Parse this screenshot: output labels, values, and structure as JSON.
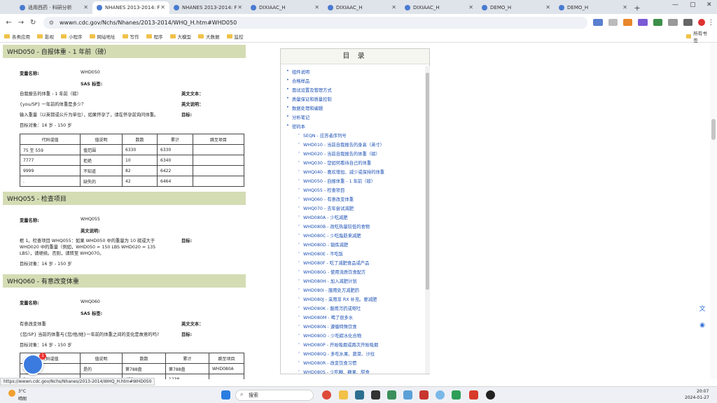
{
  "browser": {
    "tabs": [
      {
        "label": "适用西药 · 科研分析",
        "active": false
      },
      {
        "label": "NHANES 2013-2014: F",
        "active": true
      },
      {
        "label": "NHANES 2013-2014: F",
        "active": false
      },
      {
        "label": "DIXIAAC_H",
        "active": false
      },
      {
        "label": "DIXIAAC_H",
        "active": false
      },
      {
        "label": "DIXIAAC_H",
        "active": false
      },
      {
        "label": "DEMO_H",
        "active": false
      },
      {
        "label": "DEMO_H",
        "active": false
      }
    ],
    "new_tab": "+",
    "url": "wwwn.cdc.gov/Nchs/Nhanes/2013-2014/WHQ_H.htm#WHD050",
    "bookmarks": [
      "各类应用",
      "影视",
      "小程序",
      "网站地址",
      "写作",
      "程序",
      "大模型",
      "大数据",
      "监控"
    ],
    "bookmarks_right": "所有书签",
    "status_url": "https://wwwn.cdc.gov/Nchs/Nhanes/2013-2014/WHQ_H.htm#WHD050"
  },
  "sections": {
    "whd050": {
      "header": "WHD050 - 自报体重 - 1 年前（磅）",
      "var_label": "变量名称:",
      "var_value": "WHD050",
      "sas_label": "SAS 标签:",
      "desc": "自我报告的体重 - 1 年前（磅）",
      "q": "{you/SP} 一年前的体重是多少？",
      "instr": "输入重量（以英镑或公斤为单位），如果怀孕了，请在怀孕前询问体重。",
      "age": "目标对象：16 岁 - 150 岁",
      "en_text": "英文文本：",
      "en_instr": "英文说明：",
      "target": "目标:",
      "table": {
        "headers": [
          "代码或值",
          "值说明",
          "数数",
          "累计",
          "跳至项目"
        ],
        "rows": [
          [
            "75 至 559",
            "值范围",
            "6330",
            "6330",
            ""
          ],
          [
            "7777",
            "拒绝",
            "10",
            "6340",
            ""
          ],
          [
            "9999",
            "不知道",
            "82",
            "6422",
            ""
          ],
          [
            ".",
            "缺失的",
            "42",
            "6464",
            ""
          ]
        ]
      }
    },
    "whq055": {
      "header": "WHQ055 - 检查项目",
      "var_label": "变量名称:",
      "var_value": "WHQ055",
      "en_instr": "英文说明:",
      "instr1": "框 1。检查项目 WHQ055：如果 WHD050 中的重量为 10 磅或大于",
      "instr2": "WHD020 中的重量（例如，WHD050 = 150 LBS WHD020 = 135",
      "instr3": "LBS），请继续。否则，请转至 WHQ070。",
      "target": "目标:",
      "age": "目标对象：16 岁 - 150 岁"
    },
    "whq060": {
      "header": "WHQ060 - 有意改变体重",
      "var_label": "变量名称:",
      "var_value": "WHQ060",
      "sas_label": "SAS 标签:",
      "desc": "有意改变体重",
      "q": "{您/SP} 当前的体重与{您/他/她}一年前的体重之间的变化是故意的吗?",
      "age": "目标对象：16 岁 - 150 岁",
      "en_text": "英文文本：",
      "target": "目标:",
      "table": {
        "headers": [
          "代码或值",
          "值说明",
          "数数",
          "累计",
          "跳至项目"
        ],
        "rows": [
          [
            "1",
            "是的",
            "第788盘",
            "第788盘",
            "WHD080A"
          ],
          [
            "2",
            "不",
            "450",
            "1238",
            ""
          ]
        ]
      }
    }
  },
  "toc": {
    "title": "目 录",
    "items": [
      {
        "label": "组件说明",
        "level": 1
      },
      {
        "label": "合格样品",
        "level": 1
      },
      {
        "label": "面试设置及管理方式",
        "level": 1
      },
      {
        "label": "质量保证和质量控制",
        "level": 1
      },
      {
        "label": "数据处理和编辑",
        "level": 1
      },
      {
        "label": "分析笔记",
        "level": 1
      },
      {
        "label": "密码本",
        "level": 1
      },
      {
        "label": "SEQN - 应答者序列号",
        "level": 2
      },
      {
        "label": "WHD010 - 当前自我报告的身高（英寸）",
        "level": 2
      },
      {
        "label": "WHD020 - 当前自我报告的体重（磅）",
        "level": 2
      },
      {
        "label": "WHQ030 - 您如何看待自己的体重",
        "level": 2
      },
      {
        "label": "WHQ040 - 喜欢增加、减少或保持的体重",
        "level": 2
      },
      {
        "label": "WHD050 - 自报体重 - 1 年前（磅）",
        "level": 2
      },
      {
        "label": "WHQ055 - 检查项目",
        "level": 2
      },
      {
        "label": "WHQ060 - 有意改变体重",
        "level": 2
      },
      {
        "label": "WHQ070 - 去年尝试减肥",
        "level": 2
      },
      {
        "label": "WHD080A - 少吃减肥",
        "level": 2
      },
      {
        "label": "WHD080B - 改吃热量较低的食物",
        "level": 2
      },
      {
        "label": "WHD080C - 少吃脂肪来减肥",
        "level": 2
      },
      {
        "label": "WHD080D - 锻炼减肥",
        "level": 2
      },
      {
        "label": "WHD080E - 不吃饭",
        "level": 2
      },
      {
        "label": "WHD080F - 吃了减肥食品或产品",
        "level": 2
      },
      {
        "label": "WHD080G - 使用流质饮食配方",
        "level": 2
      },
      {
        "label": "WHD080H - 加入减肥计划",
        "level": 2
      },
      {
        "label": "WHD080I - 服用处方减肥药",
        "level": 2
      },
      {
        "label": "WHD080J - 采用非 RX 补充。要减肥",
        "level": 2
      },
      {
        "label": "WHD080K - 服用泻药或呕吐",
        "level": 2
      },
      {
        "label": "WHD080M - 喝了很多水",
        "level": 2
      },
      {
        "label": "WHD080N - 遵循特殊饮食",
        "level": 2
      },
      {
        "label": "WHD080O - 少吃碳水化合物",
        "level": 2
      },
      {
        "label": "WHD080P - 开始吸烟或再次开始吸烟",
        "level": 2
      },
      {
        "label": "WHD080Q - 多吃水果、蔬菜、沙拉",
        "level": 2
      },
      {
        "label": "WHD080R - 改变饮食习惯",
        "level": 2
      },
      {
        "label": "WHD080S - 少吃糖、糖果、甜食",
        "level": 2
      }
    ]
  },
  "taskbar": {
    "weather_temp": "3°C",
    "weather_desc": "晴朗",
    "search": "搜索",
    "time": "20:07",
    "date": "2024-01-27"
  },
  "colors": {
    "section_header": "#d4dcb4",
    "link": "#1a4fb5"
  }
}
